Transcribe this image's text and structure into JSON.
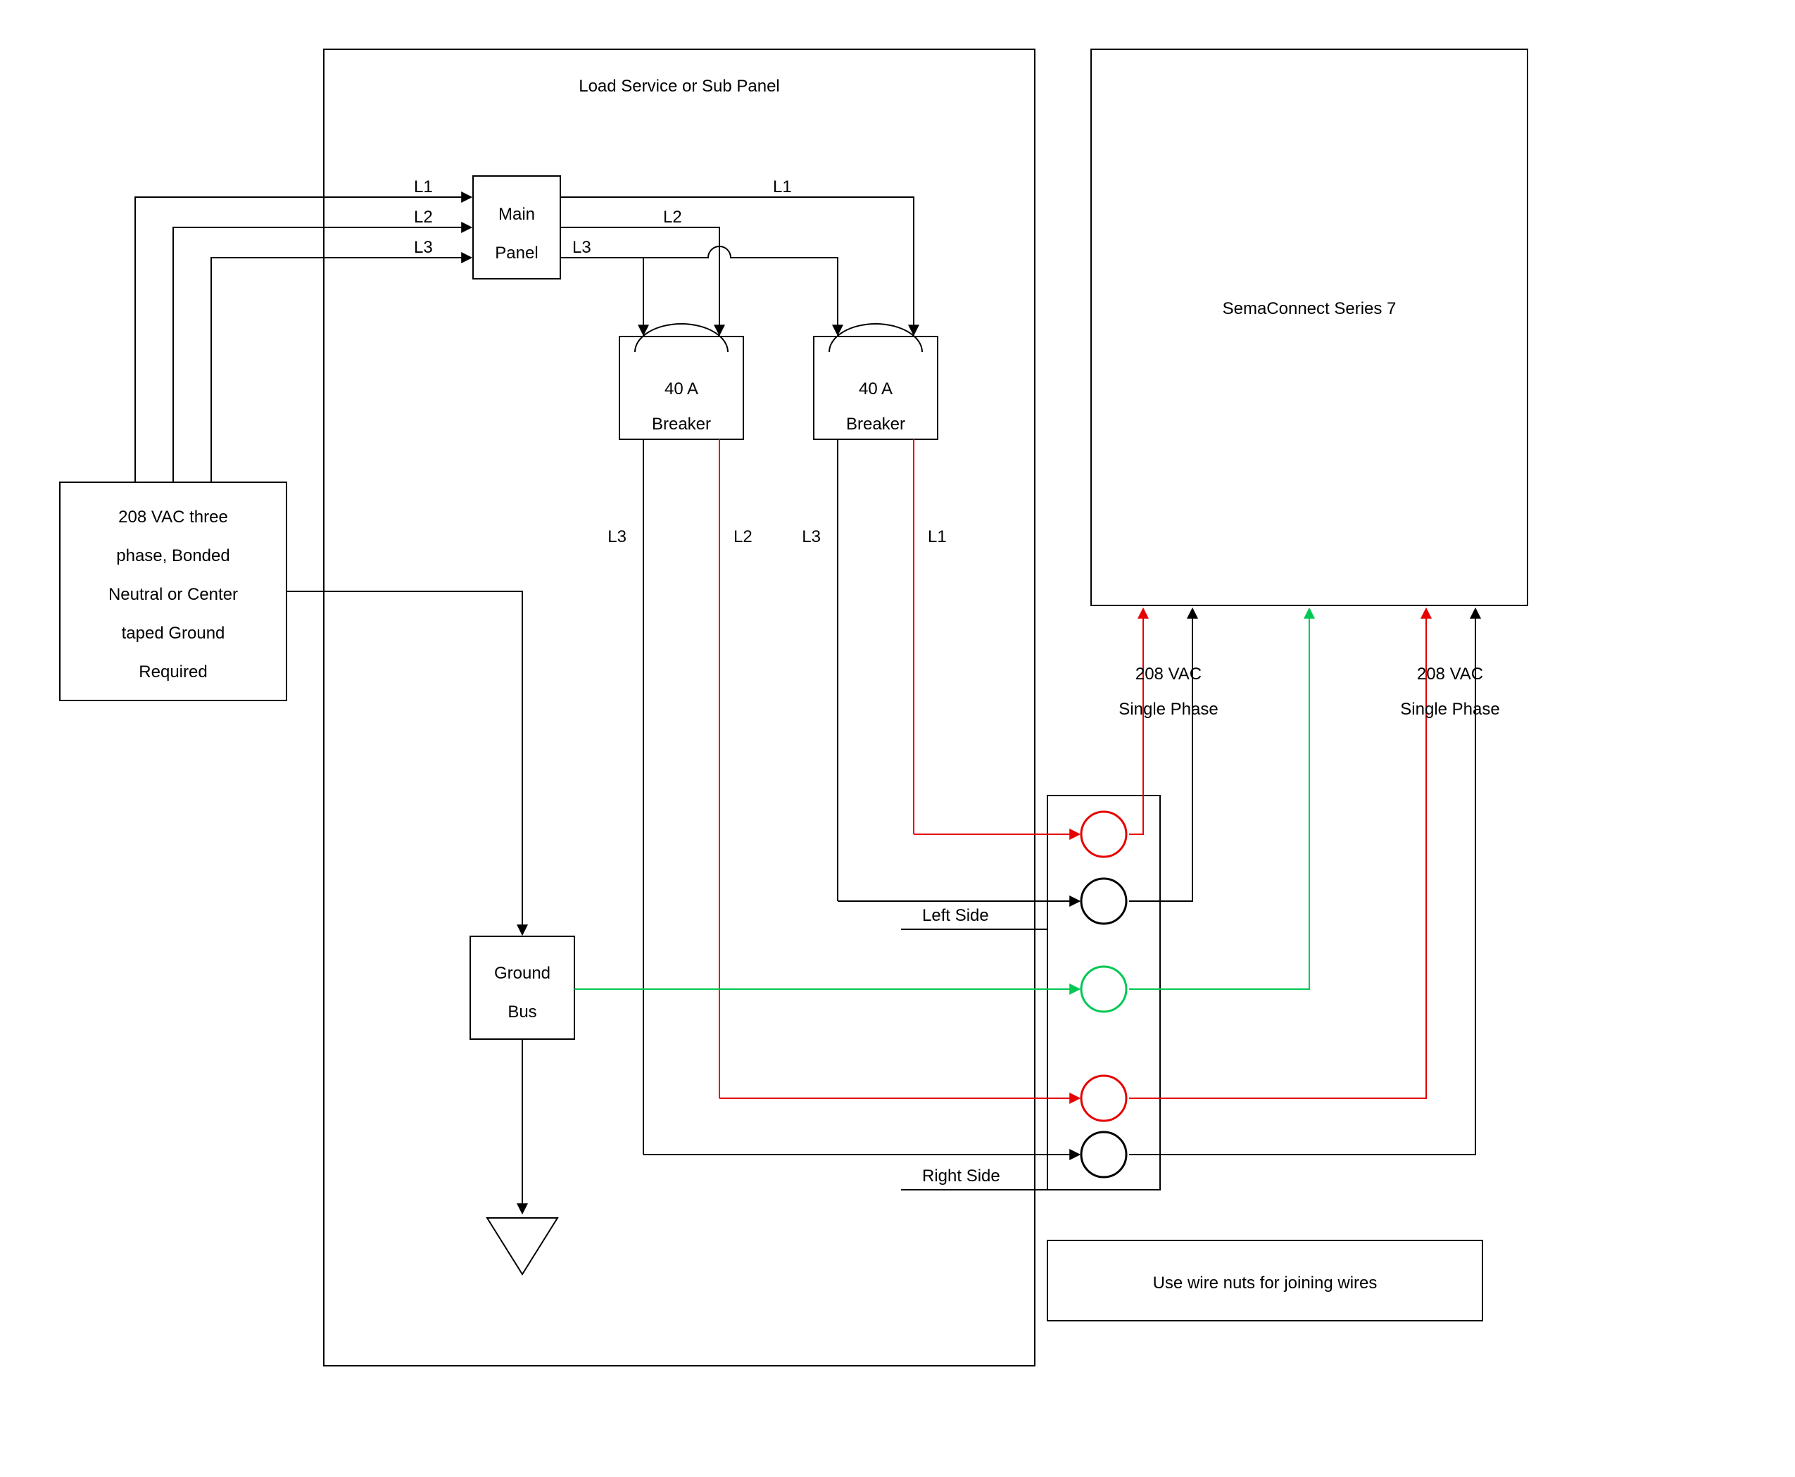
{
  "diagram": {
    "sub_panel_title": "Load Service or Sub Panel",
    "source_box": {
      "line1": "208 VAC three",
      "line2": "phase, Bonded",
      "line3": "Neutral or Center",
      "line4": "taped Ground",
      "line5": "Required"
    },
    "main_panel": {
      "line1": "Main",
      "line2": "Panel"
    },
    "breaker_left": {
      "line1": "40 A",
      "line2": "Breaker"
    },
    "breaker_right": {
      "line1": "40 A",
      "line2": "Breaker"
    },
    "ground_bus": {
      "line1": "Ground",
      "line2": "Bus"
    },
    "sema_box": "SemaConnect Series 7",
    "notes": {
      "left_side": "Left Side",
      "right_side": "Right Side",
      "phase_left": {
        "line1": "208 VAC",
        "line2": "Single Phase"
      },
      "phase_right": {
        "line1": "208 VAC",
        "line2": "Single Phase"
      },
      "wire_nuts": "Use wire nuts for joining wires"
    },
    "wire_labels": {
      "l1a": "L1",
      "l2a": "L2",
      "l3a": "L3",
      "l1b": "L1",
      "l2b": "L2",
      "l3b": "L3",
      "l1c": "L1",
      "l2c": "L2",
      "l3c": "L3",
      "l3d": "L3"
    },
    "colors": {
      "red": "#e60000",
      "green": "#00c853",
      "black": "#000000"
    }
  }
}
